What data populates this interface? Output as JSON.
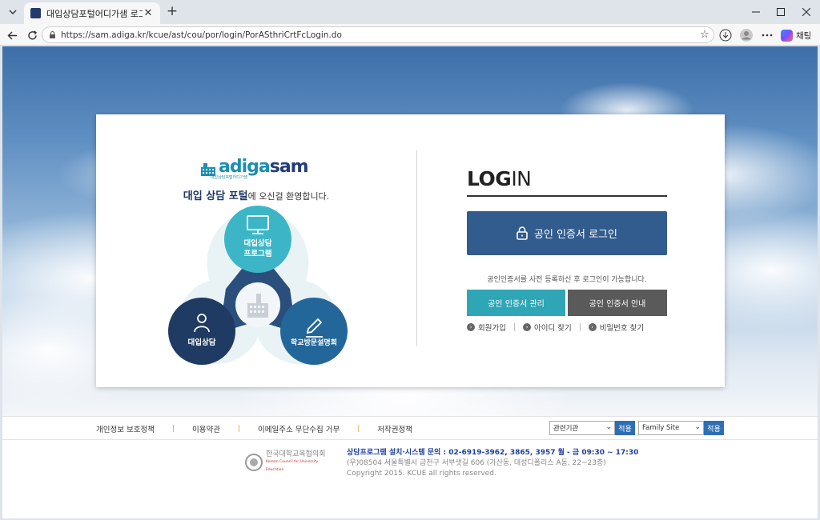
{
  "browser": {
    "tab_title": "대입상담포털어디가샘 로그인",
    "tab_close": "✕",
    "new_tab": "+",
    "url": "https://sam.adiga.kr/kcue/ast/cou/por/login/PorASthriCrtFcLogin.do",
    "copilot_label": "채팅"
  },
  "welcome": {
    "bold": "대입 상담 포털",
    "rest": "에 오신걸 환영합니다."
  },
  "logo": {
    "part1": "adiga",
    "part2": "sam",
    "sub": "대입상담포털어디가샘"
  },
  "diagram": {
    "top_label_1": "대입상담",
    "top_label_2": "프로그램",
    "left_label": "대입상담",
    "right_label": "학교방문설명회"
  },
  "login": {
    "title_bold": "LOG",
    "title_rest": "IN",
    "cert_login": "공인 인증서 로그인",
    "notice": "공인인증서를 사전 등록하신 후 로그인이 가능합니다.",
    "manage": "공인 인증서 관리",
    "guide": "공인 인증서 안내",
    "links": [
      "회원가입",
      "아이디 찾기",
      "비밀번호 찾기"
    ]
  },
  "footer": {
    "nav": [
      "개인정보 보호정책",
      "이용약관",
      "이메일주소 무단수집 거부",
      "저작권정책"
    ],
    "separator": "|",
    "select1": "관련기관",
    "select2": "Family Site",
    "apply": "적용",
    "org_name": "한국대학교육협의회",
    "org_name_en": "Korean Council for University Education",
    "contact": "상담프로그램 설치·시스템 문의 : 02-6919-3962, 3865, 3957 월 - 금 09:30 ~ 17:30",
    "address": "(우)08504 서울특별시 금천구 서부샛길 606 (가산동, 대성디폴리스 A동, 22~23층)",
    "copyright": "Copyright 2015. KCUE all rights reserved."
  },
  "colors": {
    "primary_button": "#325b8e",
    "teal_button": "#2fa6b6",
    "gray_button": "#5a5a5a",
    "apply_button": "#2d6eb5"
  }
}
